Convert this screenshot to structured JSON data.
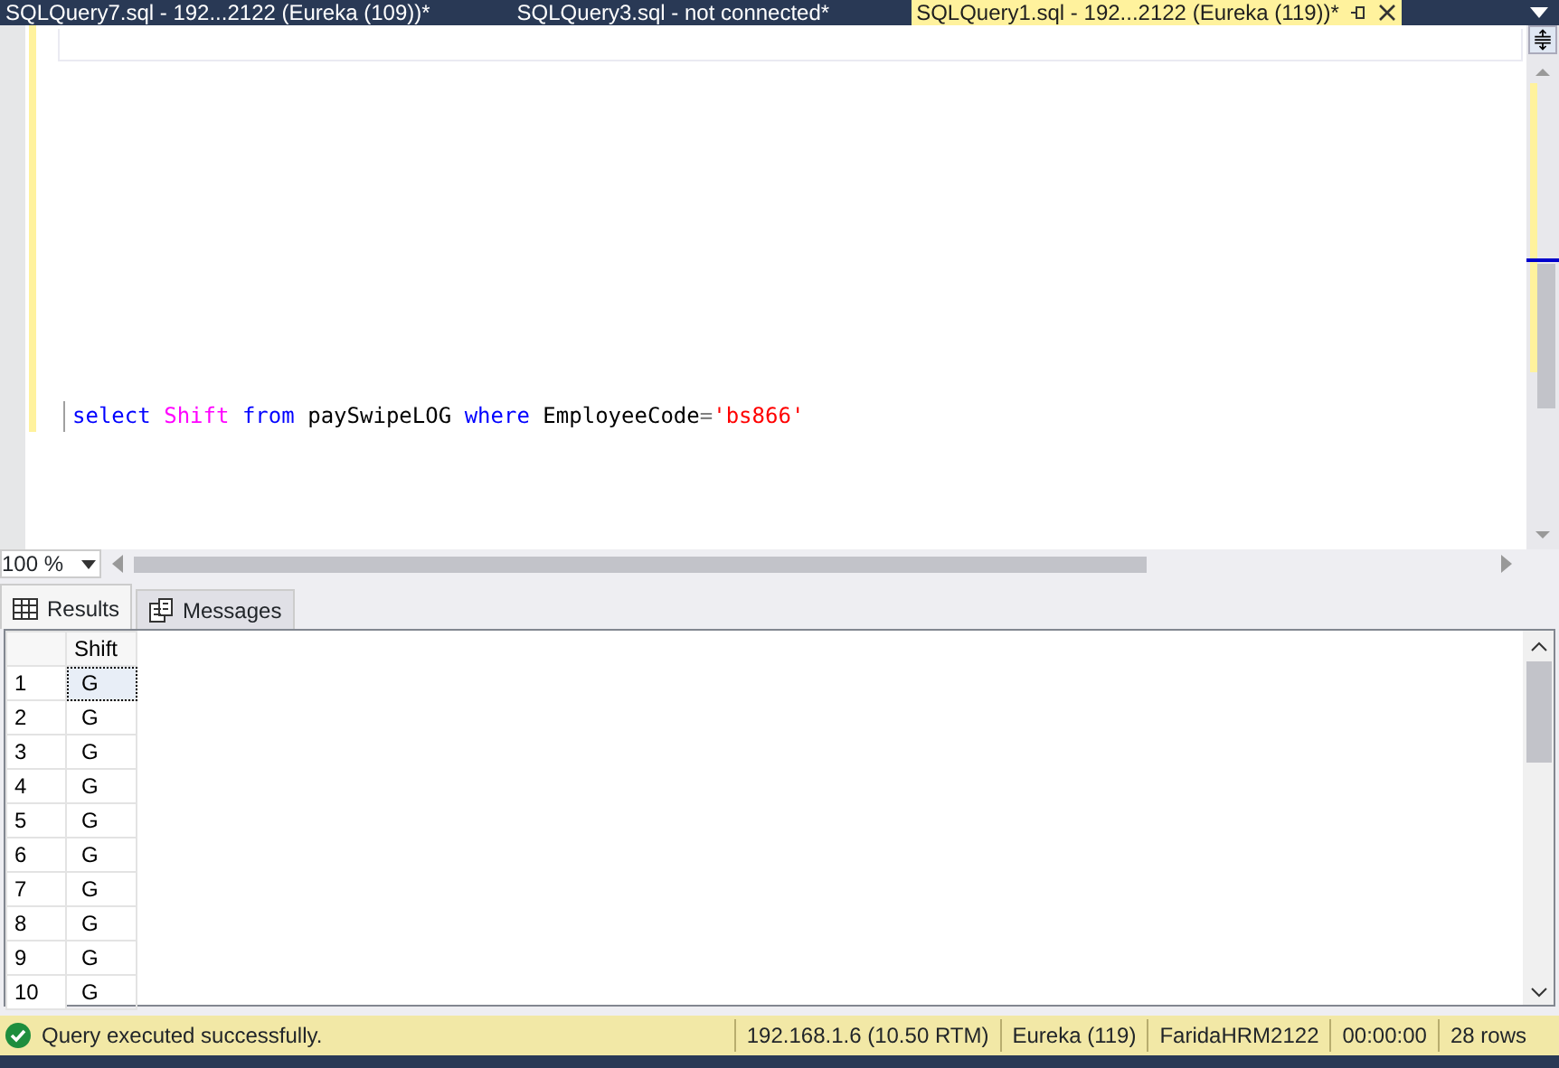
{
  "document_tabs": [
    {
      "label": "SQLQuery7.sql - 192...2122 (Eureka (109))*",
      "selected": false
    },
    {
      "label": "SQLQuery3.sql - not connected*",
      "selected": false
    },
    {
      "label": "SQLQuery1.sql - 192...2122 (Eureka (119))*",
      "selected": true
    }
  ],
  "editor": {
    "code": [
      {
        "kind": "keyword",
        "text": "select"
      },
      {
        "kind": "function",
        "text": "Shift"
      },
      {
        "kind": "keyword",
        "text": "from"
      },
      {
        "kind": "identifier",
        "text": "paySwipeLOG"
      },
      {
        "kind": "keyword",
        "text": "where"
      },
      {
        "kind": "identifier",
        "text": "EmployeeCode"
      },
      {
        "kind": "operator",
        "text": "="
      },
      {
        "kind": "string",
        "text": "'bs866'"
      }
    ],
    "zoom": "100 %"
  },
  "result_tabs": [
    {
      "label": "Results",
      "selected": true
    },
    {
      "label": "Messages",
      "selected": false
    }
  ],
  "results": {
    "columns": [
      "Shift"
    ],
    "rows": [
      {
        "number": "1",
        "cells": [
          "G"
        ]
      },
      {
        "number": "2",
        "cells": [
          "G"
        ]
      },
      {
        "number": "3",
        "cells": [
          "G"
        ]
      },
      {
        "number": "4",
        "cells": [
          "G"
        ]
      },
      {
        "number": "5",
        "cells": [
          "G"
        ]
      },
      {
        "number": "6",
        "cells": [
          "G"
        ]
      },
      {
        "number": "7",
        "cells": [
          "G"
        ]
      },
      {
        "number": "8",
        "cells": [
          "G"
        ]
      },
      {
        "number": "9",
        "cells": [
          "G"
        ]
      },
      {
        "number": "10",
        "cells": [
          "G"
        ]
      }
    ]
  },
  "status_bar": {
    "message": "Query executed successfully.",
    "fields": [
      "192.168.1.6 (10.50 RTM)",
      "Eureka (119)",
      "FaridaHRM2122",
      "00:00:00",
      "28 rows"
    ]
  }
}
